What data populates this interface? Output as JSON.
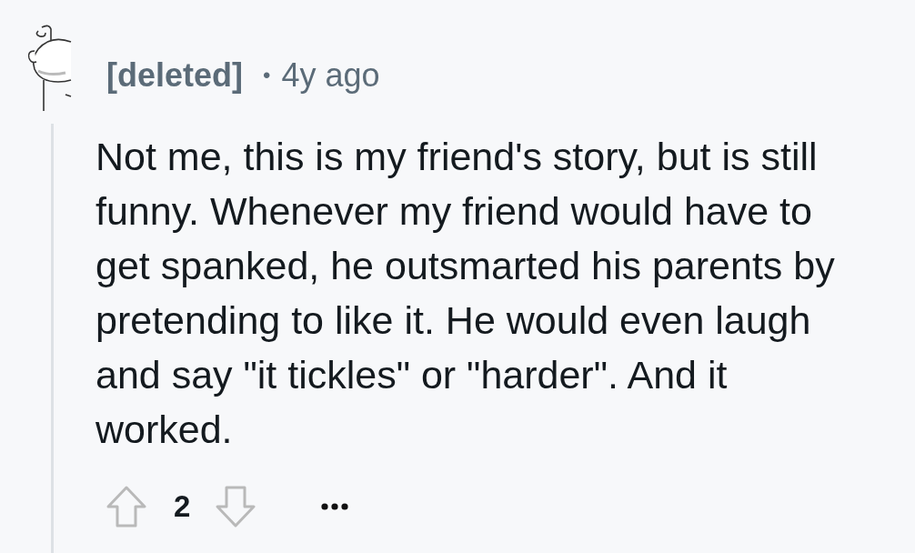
{
  "comment": {
    "author": "[deleted]",
    "separator": "•",
    "age": "4y ago",
    "body": "Not me, this is my friend's story, but is still funny. Whenever my friend would have to get spanked, he outsmarted his parents by pretending to like it. He would even laugh and say \"it tickles\" or \"harder\". And it worked.",
    "score": "2"
  }
}
